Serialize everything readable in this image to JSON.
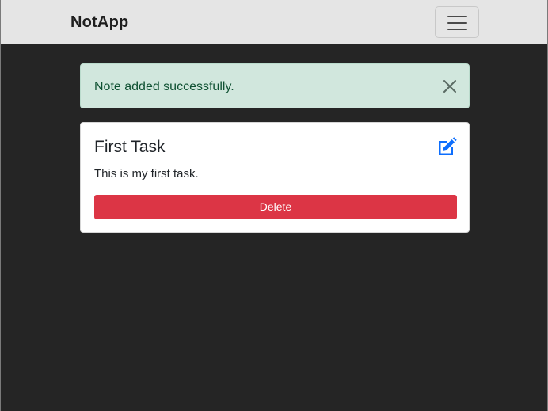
{
  "navbar": {
    "brand": "NotApp",
    "toggle_icon": "hamburger-menu-icon"
  },
  "alert": {
    "message": "Note added successfully.",
    "close_icon": "close-icon",
    "colors": {
      "background": "#d1e7dd",
      "text": "#0f5132"
    }
  },
  "note": {
    "title": "First Task",
    "body": "This is my first task.",
    "edit_icon": "edit-icon",
    "delete_label": "Delete",
    "colors": {
      "delete": "#dc3545",
      "edit": "#0d6efd"
    }
  },
  "colors": {
    "navbar": "#e5e5e5",
    "page_background": "#252525"
  }
}
